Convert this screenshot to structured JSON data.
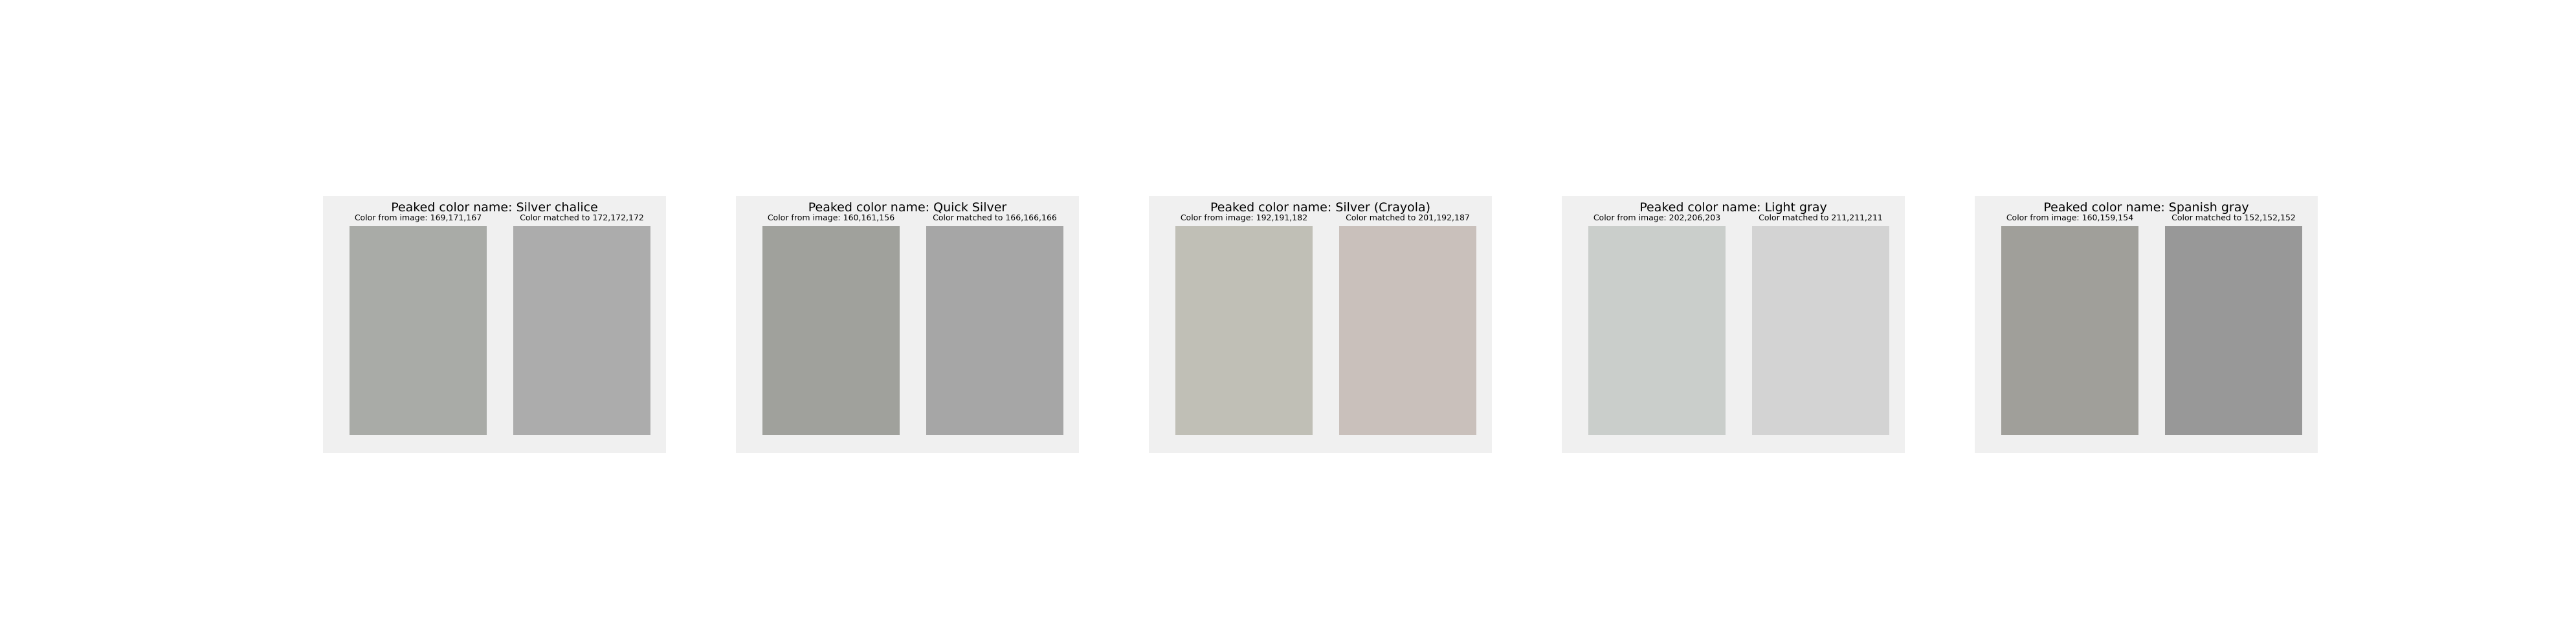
{
  "panels": [
    {
      "title": "Peaked color name: Silver chalice",
      "image_caption": "Color from image: 169,171,167",
      "matched_caption": "Color matched to 172,172,172",
      "image_color": "#a9aba7",
      "matched_color": "#acacac"
    },
    {
      "title": "Peaked color name: Quick Silver",
      "image_caption": "Color from image: 160,161,156",
      "matched_caption": "Color matched to 166,166,166",
      "image_color": "#a0a19c",
      "matched_color": "#a6a6a6"
    },
    {
      "title": "Peaked color name: Silver (Crayola)",
      "image_caption": "Color from image: 192,191,182",
      "matched_caption": "Color matched to 201,192,187",
      "image_color": "#c0bfb6",
      "matched_color": "#c9c0bb"
    },
    {
      "title": "Peaked color name: Light gray",
      "image_caption": "Color from image: 202,206,203",
      "matched_caption": "Color matched to 211,211,211",
      "image_color": "#cacecb",
      "matched_color": "#d3d3d3"
    },
    {
      "title": "Peaked color name: Spanish gray",
      "image_caption": "Color from image: 160,159,154",
      "matched_caption": "Color matched to 152,152,152",
      "image_color": "#a09f9a",
      "matched_color": "#989898"
    }
  ]
}
